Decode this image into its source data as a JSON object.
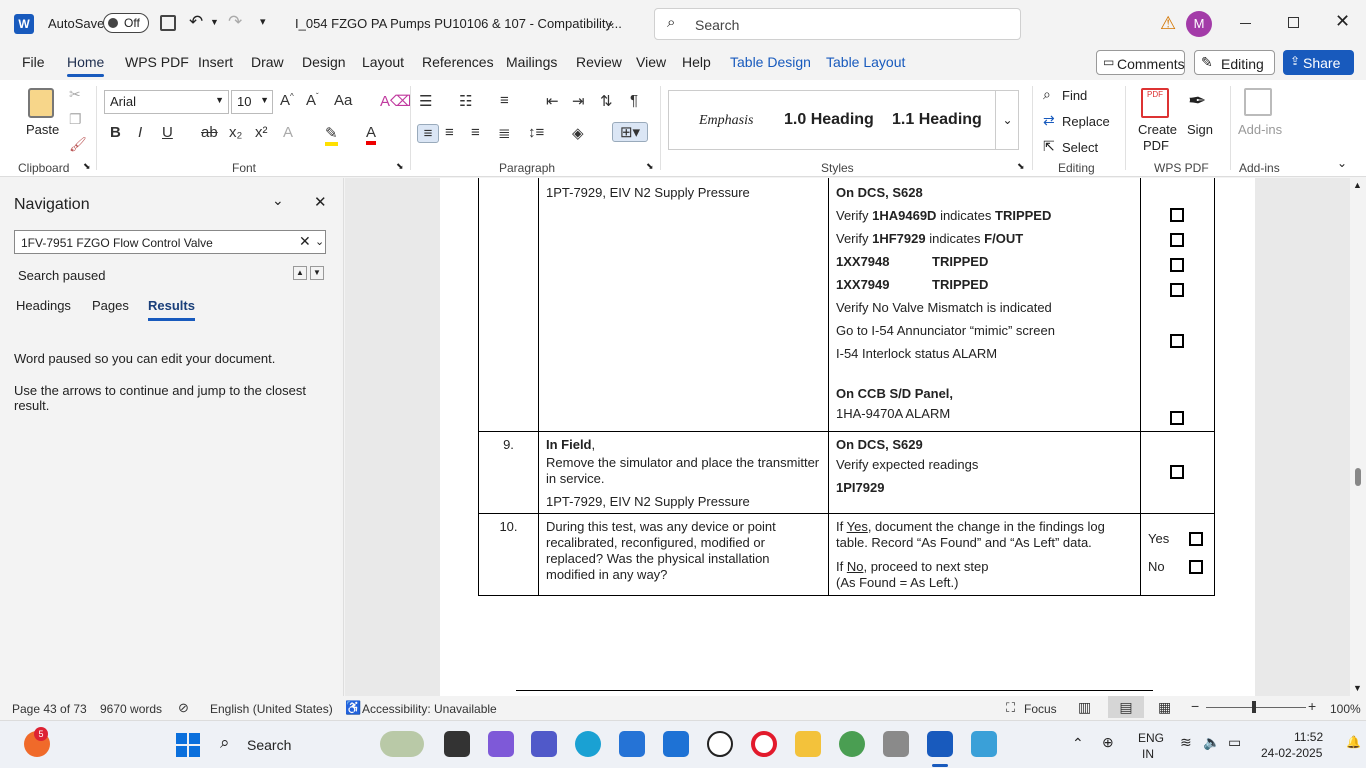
{
  "titlebar": {
    "autosave": "AutoSave",
    "toggle": "Off",
    "doc_title": "I_054 FZGO PA Pumps PU10106 & 107  -  Compatibility...",
    "search_placeholder": "Search",
    "avatar": "M"
  },
  "menu": {
    "tabs": [
      "File",
      "Home",
      "WPS PDF",
      "Insert",
      "Draw",
      "Design",
      "Layout",
      "References",
      "Mailings",
      "Review",
      "View",
      "Help",
      "Table Design",
      "Table Layout"
    ],
    "comments": "Comments",
    "editing": "Editing",
    "share": "Share"
  },
  "ribbon": {
    "paste": "Paste",
    "font_name": "Arial",
    "font_size": "10",
    "styles": [
      "Emphasis",
      "1.0  Heading",
      "1.1  Heading"
    ],
    "find": "Find",
    "replace": "Replace",
    "select": "Select",
    "create_pdf": "Create PDF",
    "sign": "Sign",
    "addins": "Add-ins",
    "groups": [
      "Clipboard",
      "Font",
      "Paragraph",
      "Styles",
      "Editing",
      "WPS PDF",
      "Add-ins"
    ]
  },
  "nav": {
    "title": "Navigation",
    "search_value": "1FV-7951 FZGO Flow Control Valve",
    "search_status": "Search paused",
    "tabs": [
      "Headings",
      "Pages",
      "Results"
    ],
    "msg1": "Word paused so you can edit your document.",
    "msg2": "Use the arrows to continue and jump to the closest result."
  },
  "table": {
    "row8": {
      "action": "1PT-7929, EIV N2 Supply Pressure",
      "lines": [
        {
          "b": "On DCS, S628",
          "t": ""
        },
        {
          "t1": "Verify ",
          "b": "1HA9469D",
          "t": " indicates ",
          "b2": "TRIPPED"
        },
        {
          "t1": "Verify ",
          "b": "1HF7929",
          "t": " indicates ",
          "b2": "F/OUT"
        },
        {
          "b": "1XX7948",
          "b2": "TRIPPED"
        },
        {
          "b": "1XX7949",
          "b2": "TRIPPED"
        },
        {
          "t1": "Verify No Valve Mismatch is indicated"
        },
        {
          "t1": "Go to I-54 Annunciator “mimic” screen"
        },
        {
          "t1": "I-54 Interlock status ALARM"
        },
        {
          "t1": ""
        },
        {
          "b": "On CCB S/D Panel,"
        },
        {
          "t1": "1HA-9470A ALARM"
        }
      ]
    },
    "row9": {
      "num": "9.",
      "field": "In Field",
      "field_tail": ",",
      "action": "Remove the simulator and place the transmitter in service.",
      "action2": "1PT-7929, EIV N2 Supply Pressure",
      "dcs": "On DCS, S629",
      "verify": "Verify expected readings",
      "reading": "1PI7929"
    },
    "row10": {
      "num": "10.",
      "question": "During this test, was any device or point recalibrated, reconfigured, modified or replaced? Was the physical installation modified in any way?",
      "yes_word": "Yes",
      "yes_text": ", document the change in the findings log table. Record “As Found” and “As Left” data.",
      "no_word": "No",
      "no_text": ", proceed to next step",
      "no_text2": "(As Found = As Left.)",
      "if": "If ",
      "yes_label": "Yes",
      "no_label": "No"
    }
  },
  "status": {
    "page": "Page 43 of 73",
    "words": "9670 words",
    "language": "English (United States)",
    "accessibility": "Accessibility: Unavailable",
    "focus": "Focus",
    "zoom": "100%"
  },
  "taskbar": {
    "search": "Search",
    "badge": "5",
    "lang1": "ENG",
    "lang2": "IN",
    "time": "11:52",
    "date": "24-02-2025"
  }
}
